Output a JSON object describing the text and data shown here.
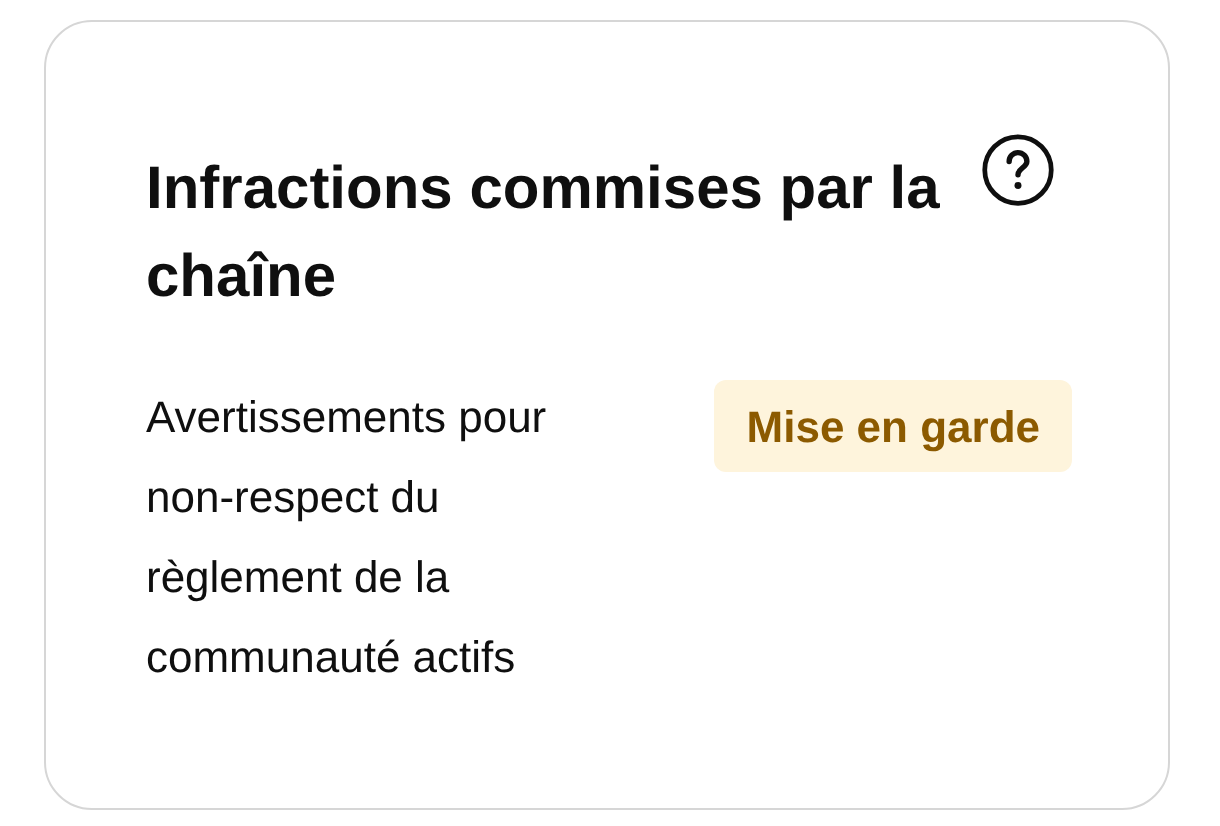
{
  "card": {
    "title": "Infractions commises par la chaîne",
    "description": "Avertissements pour non-respect du règlement de la communauté actifs",
    "status": {
      "label": "Mise en garde",
      "kind": "warning"
    }
  }
}
